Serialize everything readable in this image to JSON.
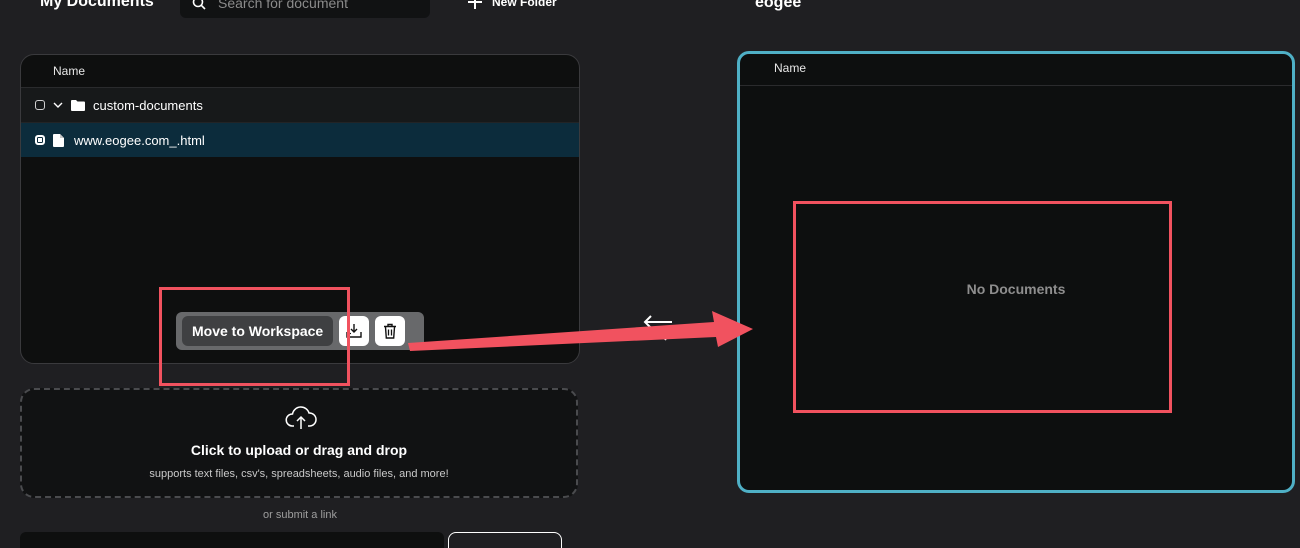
{
  "header": {
    "title": "My Documents",
    "search_placeholder": "Search for document",
    "new_folder_label": "New Folder",
    "workspace_title": "eogee"
  },
  "documents": {
    "column_name": "Name",
    "folder": {
      "name": "custom-documents",
      "checked": false
    },
    "file": {
      "name": "www.eogee.com_.html",
      "checked": true
    }
  },
  "actions": {
    "move_label": "Move to Workspace",
    "download_icon": "tray-download-icon",
    "delete_icon": "trash-icon"
  },
  "upload": {
    "title": "Click to upload or drag and drop",
    "subtitle": "supports text files, csv's, spreadsheets, audio files, and more!",
    "or_link": "or submit a link"
  },
  "workspace": {
    "column_name": "Name",
    "empty_text": "No Documents"
  },
  "colors": {
    "accent": "#4fb0c6",
    "annotation": "#f1525f",
    "selected_row": "#0c2c3c"
  }
}
